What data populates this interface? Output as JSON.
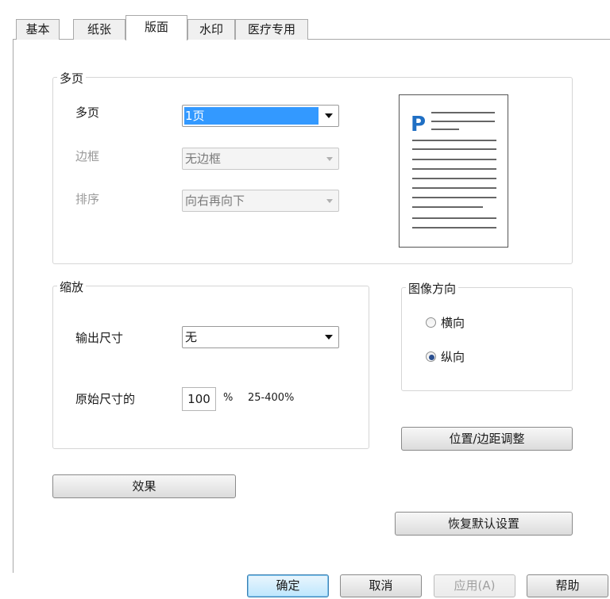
{
  "tabs": [
    "基本",
    "纸张",
    "版面",
    "水印",
    "医疗专用"
  ],
  "active_tab": "版面",
  "multipage": {
    "group_label": "多页",
    "pages_label": "多页",
    "pages_value": "1页",
    "border_label": "边框",
    "border_value": "无边框",
    "order_label": "排序",
    "order_value": "向右再向下"
  },
  "preview": {
    "letter": "P"
  },
  "scaling": {
    "group_label": "缩放",
    "output_size_label": "输出尺寸",
    "output_size_value": "无",
    "original_size_label": "原始尺寸的",
    "percent_value": "100",
    "percent_unit": "%",
    "range_hint": "25-400%"
  },
  "orientation": {
    "group_label": "图像方向",
    "landscape_label": "横向",
    "portrait_label": "纵向",
    "selected": "纵向"
  },
  "buttons": {
    "position_margin": "位置/边距调整",
    "effects": "效果",
    "restore_defaults": "恢复默认设置",
    "ok": "确定",
    "cancel": "取消",
    "apply": "应用(A)",
    "help": "帮助"
  },
  "colors": {
    "accent": "#3399ff",
    "preview_letter": "#1f6fc4"
  }
}
